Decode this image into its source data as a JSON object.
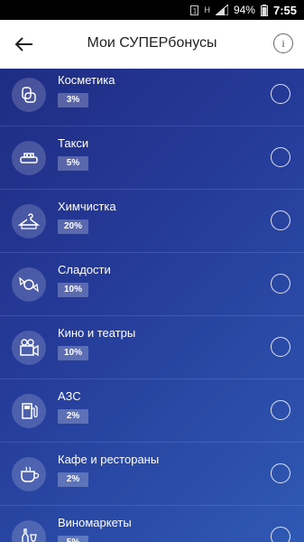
{
  "statusbar": {
    "battery": "94%",
    "time": "7:55"
  },
  "header": {
    "title": "Мои СУПЕРбонусы",
    "info_symbol": "i"
  },
  "items": [
    {
      "name": "Косметика",
      "percent": "3%",
      "icon": "cosmetics-icon"
    },
    {
      "name": "Такси",
      "percent": "5%",
      "icon": "taxi-icon"
    },
    {
      "name": "Химчистка",
      "percent": "20%",
      "icon": "hanger-icon"
    },
    {
      "name": "Сладости",
      "percent": "10%",
      "icon": "candy-icon"
    },
    {
      "name": "Кино и театры",
      "percent": "10%",
      "icon": "movie-camera-icon"
    },
    {
      "name": "АЗС",
      "percent": "2%",
      "icon": "fuel-station-icon"
    },
    {
      "name": "Кафе и рестораны",
      "percent": "2%",
      "icon": "coffee-cup-icon"
    },
    {
      "name": "Виномаркеты",
      "percent": "5%",
      "icon": "wine-bottle-icon"
    }
  ]
}
